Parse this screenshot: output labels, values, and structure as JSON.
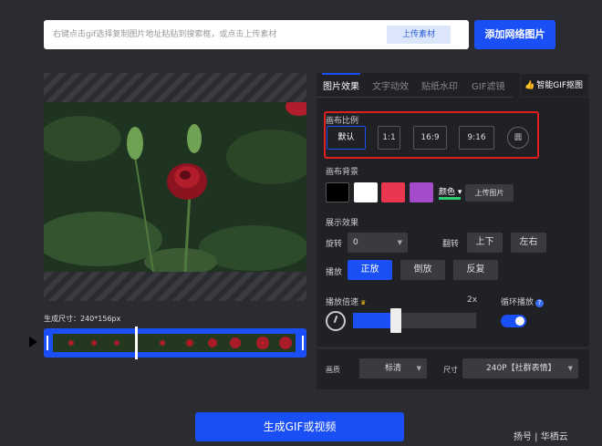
{
  "search": {
    "placeholder": "右键点击gif选择复制图片地址粘贴到搜索框，或点击上传素材",
    "upload_label": "上传素材"
  },
  "add_web_image_label": "添加网络图片",
  "preview": {
    "size_label": "生成尺寸：240*156px"
  },
  "tabs": [
    {
      "label": "图片效果",
      "active": true
    },
    {
      "label": "文字动效",
      "active": false
    },
    {
      "label": "贴纸水印",
      "active": false
    },
    {
      "label": "GIF滤镜",
      "active": false
    }
  ],
  "smart_cutout_label": "智能GIF抠图",
  "canvas_ratio": {
    "title": "画布比例",
    "options": [
      "默认",
      "1:1",
      "16:9",
      "9:16"
    ],
    "circle_label": "圆",
    "selected": "默认"
  },
  "canvas_bg": {
    "title": "画布背景",
    "swatches": [
      "#000000",
      "#ffffff",
      "#e8374e",
      "#a44bc9"
    ],
    "color_label": "颜色",
    "upload_label": "上传图片"
  },
  "display": {
    "title": "展示效果",
    "rotate_label": "旋转",
    "rotate_value": "0",
    "flip_label": "翻转",
    "flip_up_down": "上下",
    "flip_left_right": "左右",
    "play_label": "播放",
    "play_forward": "正放",
    "play_reverse": "倒放",
    "play_repeat": "反复"
  },
  "speed": {
    "label": "播放倍速",
    "value": "2x",
    "level": 0.35,
    "loop_label": "循环播放",
    "loop_on": true
  },
  "quality": {
    "label": "画质",
    "value": "标清",
    "size_label": "尺寸",
    "size_value": "240P【社群表情】"
  },
  "generate_label": "生成GIF或视频",
  "watermark": "扬号 | 华栖云"
}
